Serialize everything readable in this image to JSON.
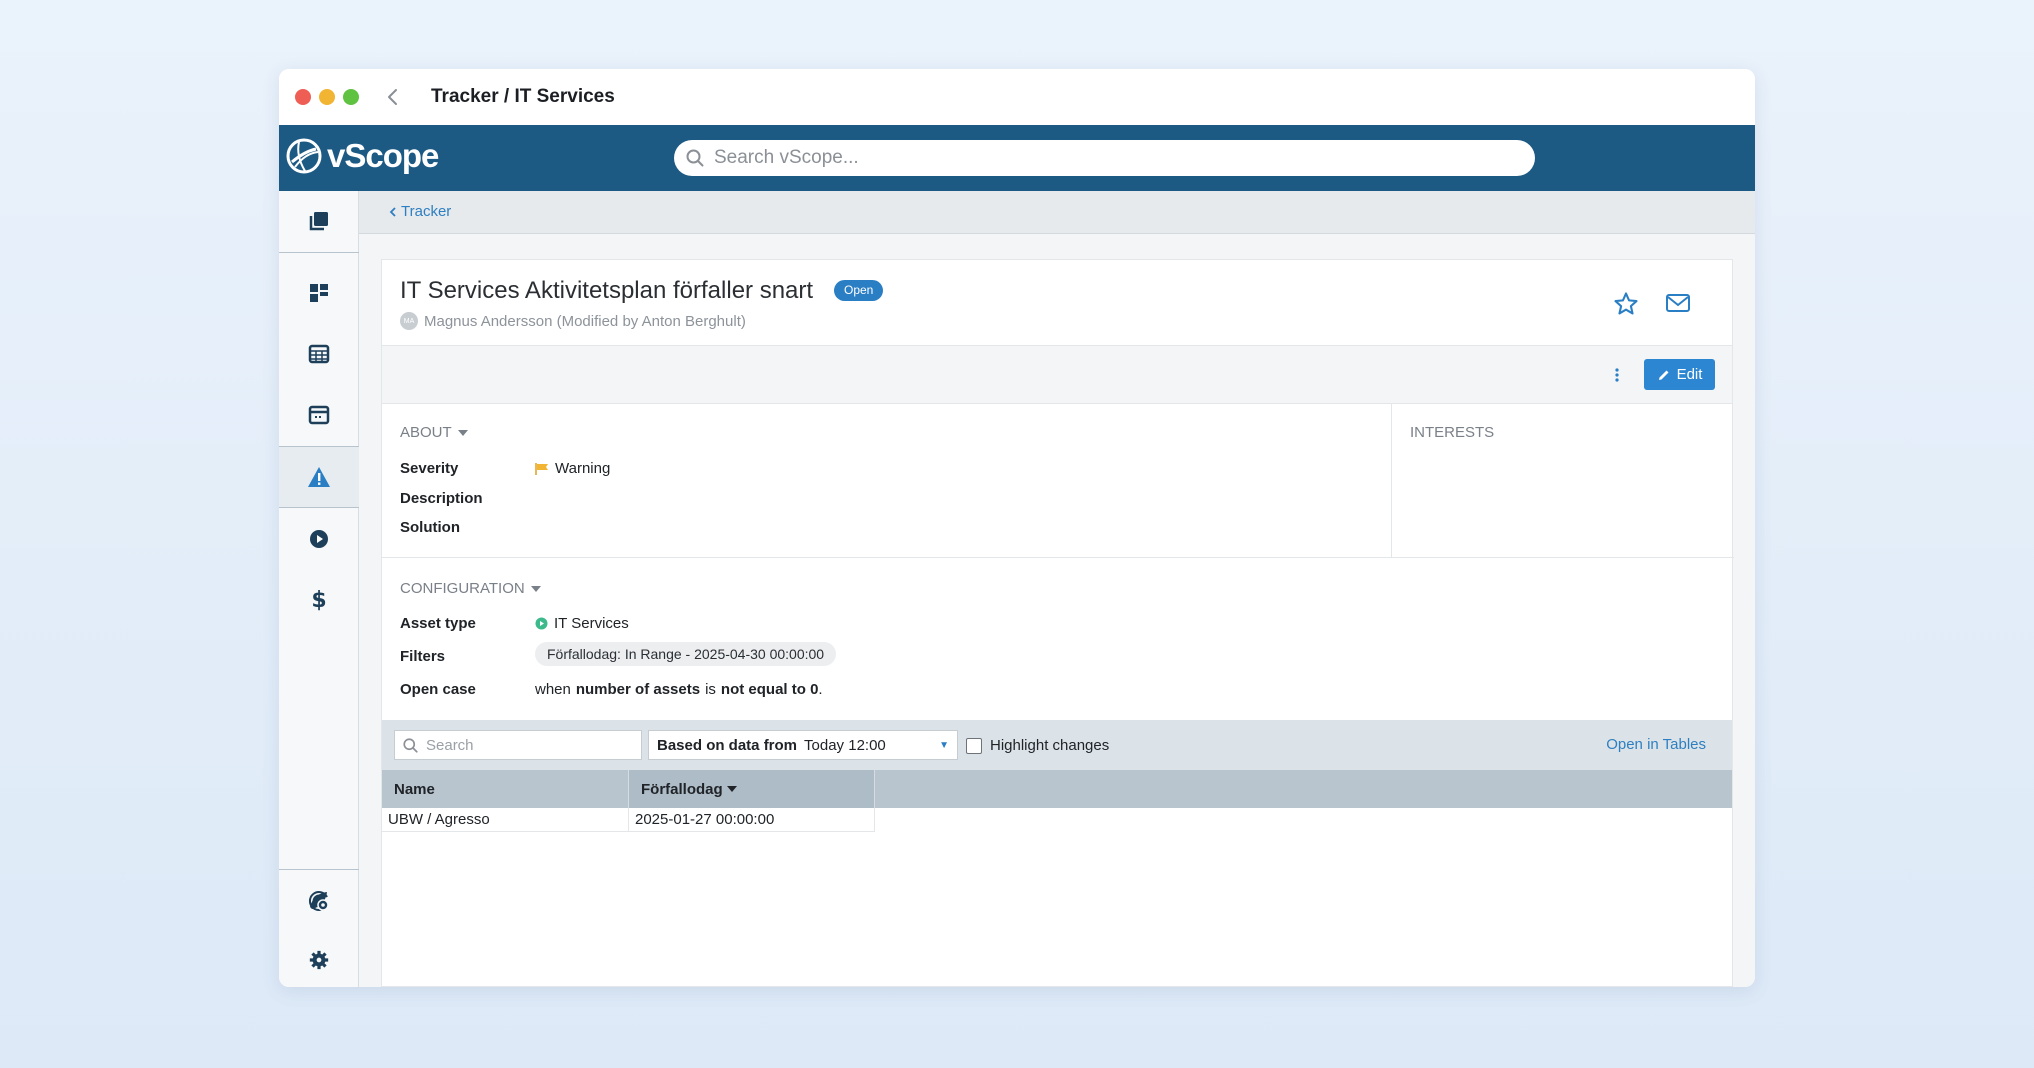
{
  "window": {
    "title": "Tracker / IT Services"
  },
  "topbar": {
    "logo_text": "vScope",
    "search_placeholder": "Search vScope..."
  },
  "sidebar": {
    "items": [
      {
        "icon": "layers-icon"
      },
      {
        "icon": "dashboard-icon"
      },
      {
        "icon": "table-icon"
      },
      {
        "icon": "browser-window-icon"
      },
      {
        "icon": "warning-icon",
        "active": true
      },
      {
        "icon": "play-circle-icon"
      },
      {
        "icon": "dollar-icon"
      },
      {
        "icon": "radar-icon"
      },
      {
        "icon": "rocket-gear-icon"
      },
      {
        "icon": "gear-icon"
      }
    ]
  },
  "breadcrumb": {
    "label": "Tracker"
  },
  "tracker": {
    "title": "IT Services Aktivitetsplan förfaller snart",
    "status": "Open",
    "avatar_initials": "MA",
    "byline": "Magnus Andersson (Modified by Anton Berghult)"
  },
  "toolbar": {
    "edit_label": "Edit"
  },
  "about": {
    "heading": "ABOUT",
    "severity_label": "Severity",
    "severity_value": "Warning",
    "description_label": "Description",
    "solution_label": "Solution"
  },
  "interests": {
    "heading": "INTERESTS"
  },
  "configuration": {
    "heading": "CONFIGURATION",
    "asset_type_label": "Asset type",
    "asset_type_value": "IT Services",
    "filters_label": "Filters",
    "filter_chip": "Förfallodag: In Range - 2025-04-30 00:00:00",
    "open_case_label": "Open case",
    "open_case_prefix": "when",
    "open_case_metric": "number of assets",
    "open_case_is": "is",
    "open_case_operator": "not equal to 0",
    "open_case_end": "."
  },
  "filterbar": {
    "search_placeholder": "Search",
    "based_on_label": "Based on data from",
    "based_on_value": "Today 12:00",
    "highlight_label": "Highlight changes",
    "open_in_tables": "Open in Tables"
  },
  "table": {
    "columns": [
      "Name",
      "Förfallodag"
    ],
    "rows": [
      [
        "UBW / Agresso",
        "2025-01-27 00:00:00"
      ]
    ]
  },
  "colors": {
    "brand": "#1c5a84",
    "accent": "#2a7ec4",
    "warning": "#f2b433",
    "asset_green": "#3cba8c"
  }
}
